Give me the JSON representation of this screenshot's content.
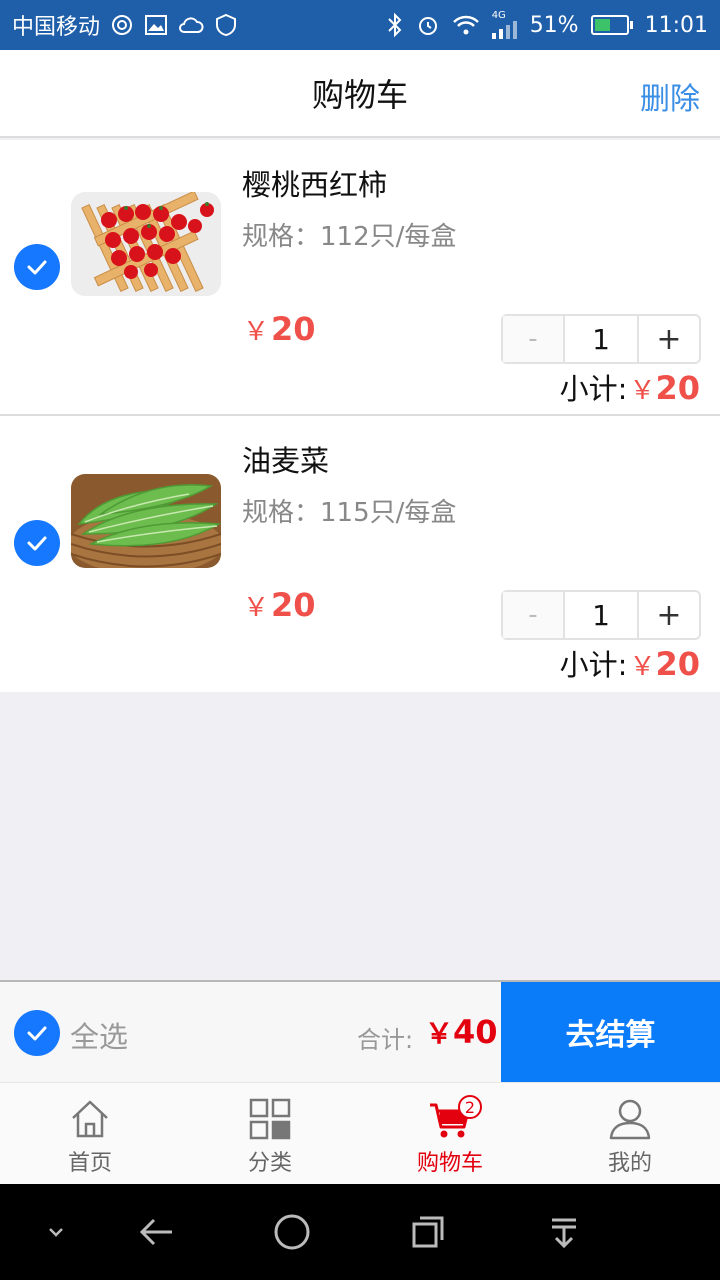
{
  "status_bar": {
    "carrier": "中国移动",
    "network": "4G",
    "battery_percent": "51%",
    "battery_level": 0.51,
    "time": "11:01"
  },
  "header": {
    "title": "购物车",
    "delete_label": "删除"
  },
  "cart_items": [
    {
      "name": "樱桃西红柿",
      "spec": "规格：112只/每盒",
      "price_symbol": "￥",
      "price": "20",
      "minus": "-",
      "quantity": "1",
      "plus": "+",
      "subtotal_label": "小计:",
      "subtotal_symbol": "￥",
      "subtotal": "20",
      "image_icon": "cherry-tomatoes-image",
      "checked": true
    },
    {
      "name": "油麦菜",
      "spec": "规格：115只/每盒",
      "price_symbol": "￥",
      "price": "20",
      "minus": "-",
      "quantity": "1",
      "plus": "+",
      "subtotal_label": "小计:",
      "subtotal_symbol": "￥",
      "subtotal": "20",
      "image_icon": "lettuce-image",
      "checked": true
    }
  ],
  "checkout": {
    "select_all_label": "全选",
    "total_label": "合计:",
    "total_symbol": "￥",
    "total_value": "40",
    "checkout_label": "去结算"
  },
  "tabs": [
    {
      "label": "首页",
      "icon": "home-icon",
      "active": false
    },
    {
      "label": "分类",
      "icon": "grid-icon",
      "active": false
    },
    {
      "label": "购物车",
      "icon": "cart-icon",
      "active": true,
      "badge": "2"
    },
    {
      "label": "我的",
      "icon": "user-icon",
      "active": false
    }
  ],
  "colors": {
    "status_bar": "#1f5ea8",
    "accent_blue": "#0a7cfa",
    "price_red": "#f0504a",
    "active_tab": "#e3000f"
  }
}
